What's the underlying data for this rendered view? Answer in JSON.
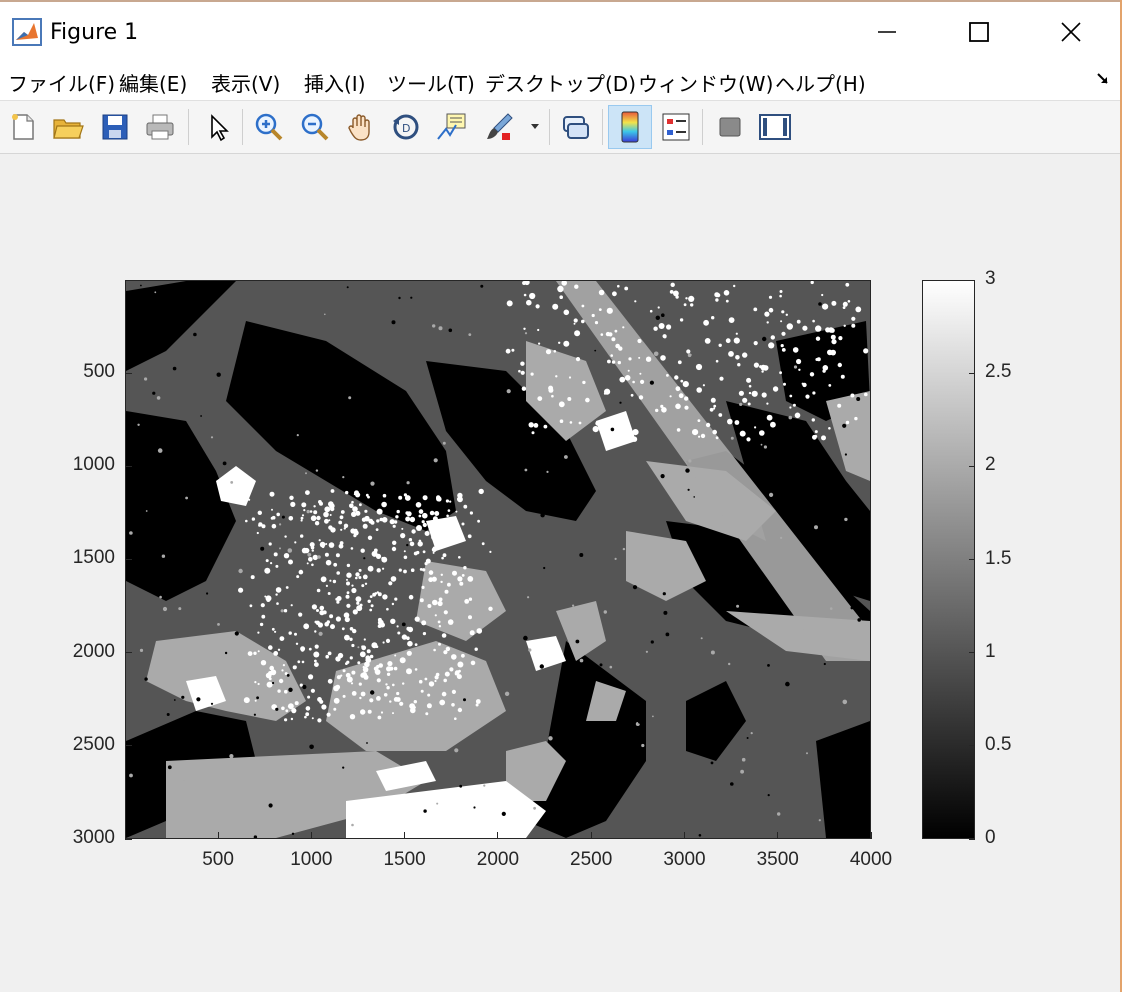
{
  "window": {
    "title": "Figure 1"
  },
  "menu": {
    "items": [
      "ファイル(F)",
      "編集(E)",
      "表示(V)",
      "挿入(I)",
      "ツール(T)",
      "デスクトップ(D)",
      "ウィンドウ(W)",
      "ヘルプ(H)"
    ]
  },
  "toolbar": {
    "buttons": [
      "new-figure",
      "open-file",
      "save",
      "print",
      "edit-plot",
      "zoom-in",
      "zoom-out",
      "pan",
      "rotate-3d",
      "data-cursor",
      "brush",
      "link-plot",
      "colorbar",
      "legend",
      "hide-plot-tools",
      "show-plot-tools"
    ]
  },
  "chart_data": {
    "type": "heatmap",
    "title": "",
    "xlabel": "",
    "ylabel": "",
    "xlim": [
      1,
      4000
    ],
    "ylim": [
      1,
      3000
    ],
    "xticks": [
      "500",
      "1000",
      "1500",
      "2000",
      "2500",
      "3000",
      "3500",
      "4000"
    ],
    "yticks": [
      "500",
      "1000",
      "1500",
      "2000",
      "2500",
      "3000"
    ],
    "x_tick_values": [
      500,
      1000,
      1500,
      2000,
      2500,
      3000,
      3500,
      4000
    ],
    "y_tick_values": [
      500,
      1000,
      1500,
      2000,
      2500,
      3000
    ],
    "colormap": "gray",
    "clim": [
      0,
      3
    ],
    "colorbar_ticks": [
      "0",
      "0.5",
      "1",
      "1.5",
      "2",
      "2.5",
      "3"
    ],
    "colorbar_values": [
      0,
      0.5,
      1,
      1.5,
      2,
      2.5,
      3
    ],
    "levels": [
      0,
      1,
      2,
      3
    ],
    "level_colors": [
      "#000000",
      "#555555",
      "#aaaaaa",
      "#ffffff"
    ]
  }
}
